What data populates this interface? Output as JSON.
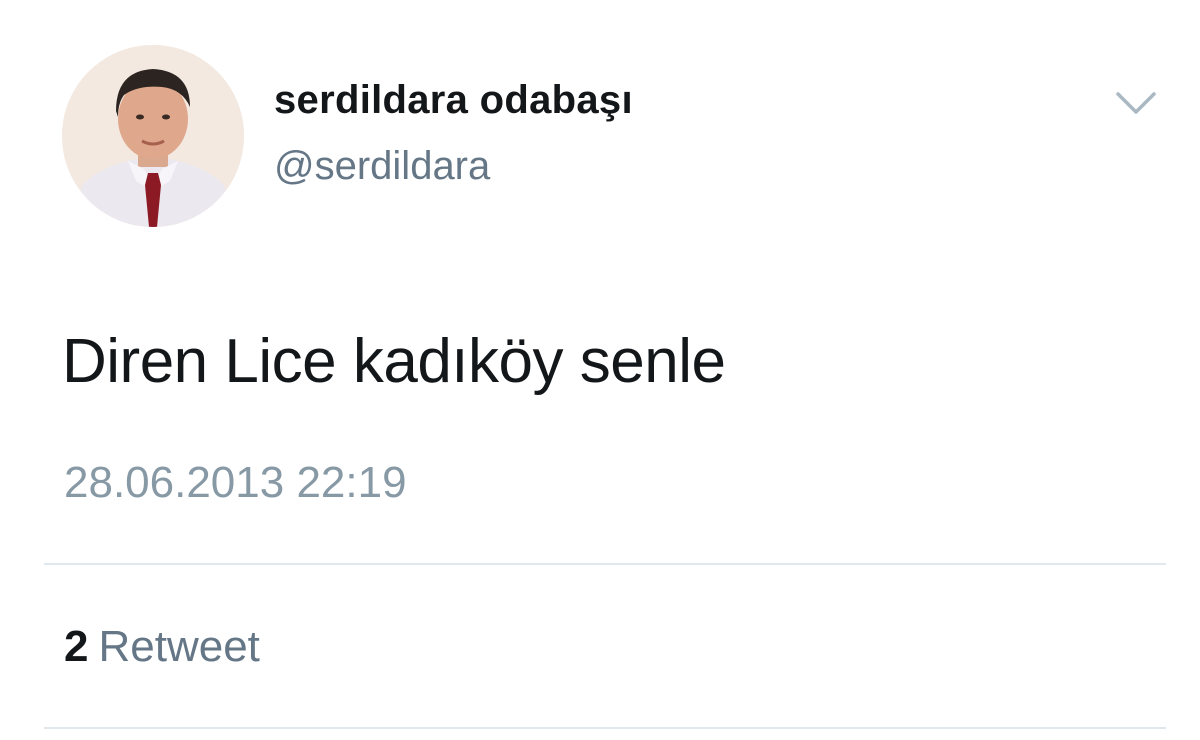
{
  "user": {
    "display_name": "serdildara odabaşı",
    "handle": "@serdildara",
    "avatar": "profile-photo"
  },
  "menu": {
    "icon": "chevron-down-icon"
  },
  "tweet": {
    "text": "Diren Lice kadıköy senle",
    "timestamp": "28.06.2013 22:19"
  },
  "stats": {
    "retweet_count": "2",
    "retweet_label": "Retweet"
  },
  "colors": {
    "primary_text": "#14171a",
    "secondary_text": "#657786",
    "timestamp_text": "#8899a6",
    "divider": "#e1e8ed"
  }
}
